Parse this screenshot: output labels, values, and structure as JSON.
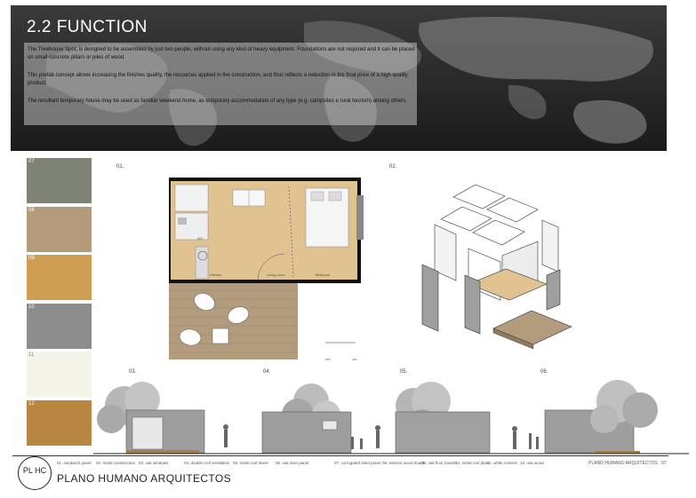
{
  "header": {
    "title": "2.2 FUNCTION",
    "p1": "The Treehouse Spot, is designed to be assembled by just two people, without using any kind of heavy equipment. Foundations are not required and it can be placed on small concrete pillars or piles of wood.",
    "p2": "This prefab concept allows increasing the finishes quality, the resources applied in the construction, and thus reflects a reduction in the final price of a high quality product.",
    "p3": "The resultant temporary house may be used as familiar weekend home, as temporary accommodation of any type (e.g. campsites e rural tourism) among others."
  },
  "swatches": [
    {
      "num": "07",
      "color": "#7f8376"
    },
    {
      "num": "08",
      "color": "#b39b7c"
    },
    {
      "num": "09",
      "color": "#cf9e55"
    },
    {
      "num": "10",
      "color": "#8c8c8c"
    },
    {
      "num": "11",
      "color": "#f4f3ea"
    },
    {
      "num": "12",
      "color": "#b88640"
    }
  ],
  "figures": {
    "f01": "01.",
    "f02": "02.",
    "f03": "03.",
    "f04": "04.",
    "f05": "05.",
    "f06": "06."
  },
  "plan_labels": {
    "kitchen": "Kitchen",
    "living": "Living room",
    "bedroom": "Bedroom",
    "wc": "WC",
    "scale_a": "0m",
    "scale_b": "1m"
  },
  "legend": [
    "01. sandwich panel",
    "02. metal construction",
    "03. oak windows",
    "04. double roof ventilation",
    "05. metal roof sheet",
    "06. oak door panel",
    "07. corrugated steel panel",
    "08. exterior wood board",
    "09. oak floor boards",
    "10. metal roof plate",
    "11. white cement",
    "12. oak wood"
  ],
  "footer": {
    "company_right": "PLANO HUMANO ARQUITECTOS",
    "page": "07",
    "logo_text": "PLANO HUMANO ARQUITECTOS",
    "logo_mark": "PL HC"
  }
}
